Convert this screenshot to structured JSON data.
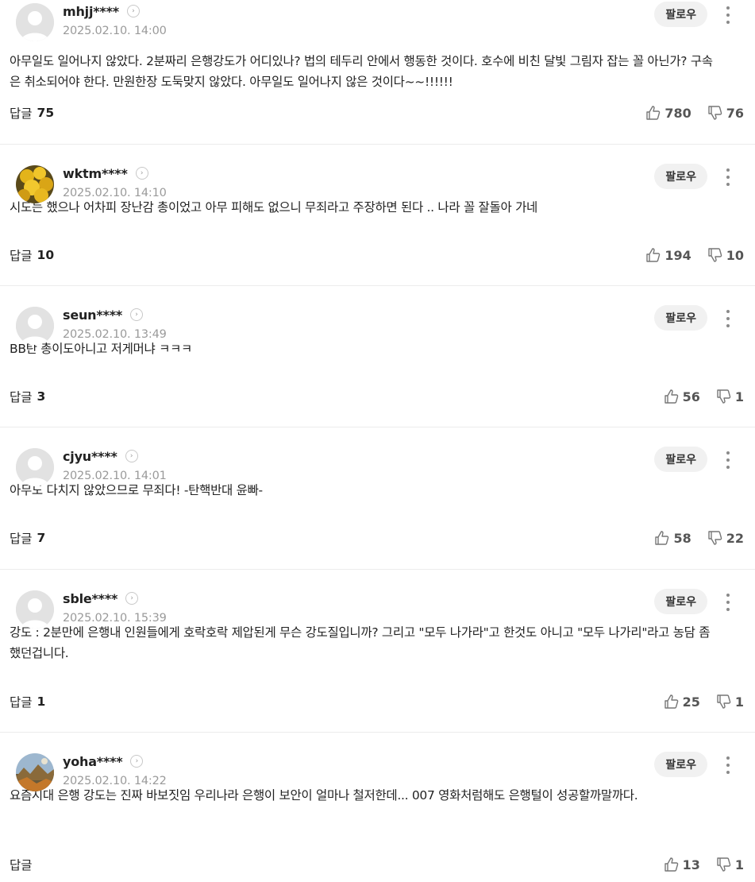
{
  "follow_label": "팔로우",
  "reply_label": "답글",
  "comments": [
    {
      "nick": "mhjj****",
      "date": "2025.02.10. 14:00",
      "text": "아무일도 일어나지 않았다. 2분짜리 은행강도가 어디있나? 법의 테두리 안에서 행동한 것이다. 호수에 비친 달빛 그림자 잡는 꼴 아닌가? 구속은 취소되어야 한다. 만원한장 도둑맞지 않았다. 아무일도 일어나지 않은 것이다~~!!!!!!",
      "replies": "75",
      "likes": "780",
      "dislikes": "76",
      "avatar_icon": "default-person"
    },
    {
      "nick": "wktm****",
      "date": "2025.02.10. 14:10",
      "text": "시도는 했으나 어차피 장난감 총이었고 아무 피해도 없으니 무죄라고 주장하면 된다 .. 나라 꼴 잘돌아 가네",
      "replies": "10",
      "likes": "194",
      "dislikes": "10",
      "avatar_icon": "yellow-flower-photo"
    },
    {
      "nick": "seun****",
      "date": "2025.02.10. 13:49",
      "text": "BB탄 총이도아니고 저게머냐 ㅋㅋㅋ",
      "replies": "3",
      "likes": "56",
      "dislikes": "1",
      "avatar_icon": "default-person"
    },
    {
      "nick": "cjyu****",
      "date": "2025.02.10. 14:01",
      "text": "아무도 다치지 않았으므로 무죄다! -탄핵반대 윤빠-",
      "replies": "7",
      "likes": "58",
      "dislikes": "22",
      "avatar_icon": "default-person"
    },
    {
      "nick": "sble****",
      "date": "2025.02.10. 15:39",
      "text": "강도 : 2분만에 은행내 인원들에게 호락호락 제압된게 무슨 강도질입니까? 그리고 \"모두 나가라\"고 한것도 아니고 \"모두 나가리\"라고 농담 좀 했던겁니다.",
      "replies": "1",
      "likes": "25",
      "dislikes": "1",
      "avatar_icon": "default-person"
    },
    {
      "nick": "yoha****",
      "date": "2025.02.10. 14:22",
      "text": "요즘시대 은행 강도는 진짜 바보짓임 우리나라 은행이 보안이 얼마나 철저한데... 007 영화처럼해도 은행털이 성공할까말까다.",
      "replies": "",
      "likes": "13",
      "dislikes": "1",
      "avatar_icon": "landscape-photo"
    }
  ]
}
